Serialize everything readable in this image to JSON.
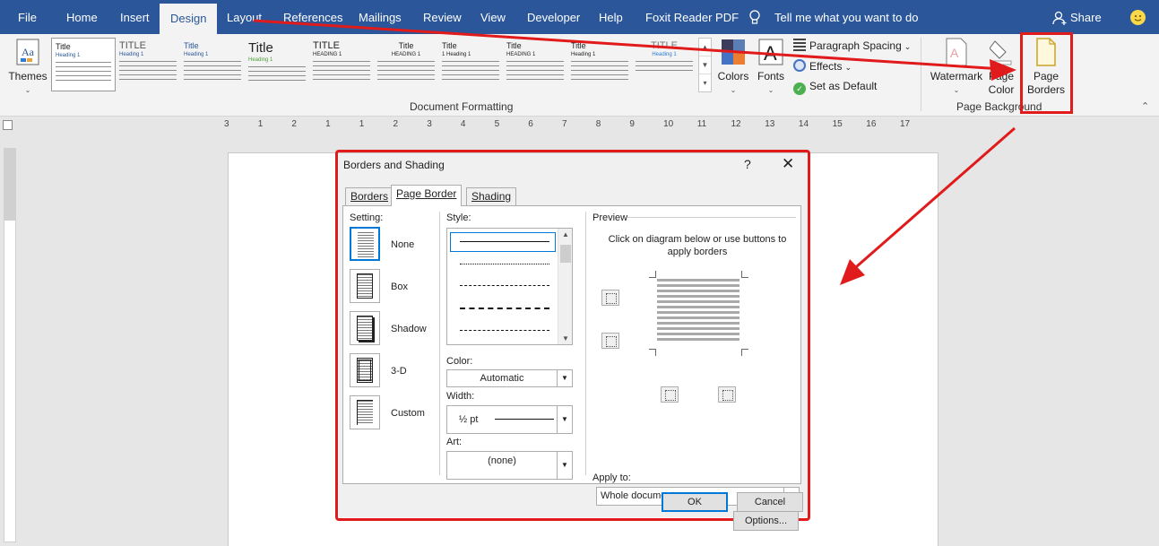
{
  "ribbon_tabs": [
    "File",
    "Home",
    "Insert",
    "Design",
    "Layout",
    "References",
    "Mailings",
    "Review",
    "View",
    "Developer",
    "Help",
    "Foxit Reader PDF"
  ],
  "active_tab": "Design",
  "tell_me": "Tell me what you want to do",
  "share": "Share",
  "ribbon": {
    "themes": "Themes",
    "styles": [
      {
        "title": "Title",
        "heading": "Heading 1"
      },
      {
        "title": "TITLE",
        "heading": "Heading 1"
      },
      {
        "title": "Title",
        "heading": "Heading 1"
      },
      {
        "title": "Title",
        "heading": "Heading 1"
      },
      {
        "title": "TITLE",
        "heading": "HEADING 1"
      },
      {
        "title": "Title",
        "heading": "HEADING 1"
      },
      {
        "title": "Title",
        "heading": "1  Heading 1"
      },
      {
        "title": "Title",
        "heading": "HEADING 1"
      },
      {
        "title": "Title",
        "heading": "Heading 1"
      },
      {
        "title": "TITLE",
        "heading": "Heading 1"
      }
    ],
    "colors": "Colors",
    "fonts": "Fonts",
    "paragraph_spacing": "Paragraph Spacing",
    "effects": "Effects",
    "set_as_default": "Set as Default",
    "document_formatting": "Document Formatting",
    "watermark": "Watermark",
    "page_color_line1": "Page",
    "page_color_line2": "Color",
    "page_borders_line1": "Page",
    "page_borders_line2": "Borders",
    "page_background": "Page Background"
  },
  "ruler_numbers": [
    "3",
    "1",
    "2",
    "1",
    "1",
    "2",
    "3",
    "4",
    "5",
    "6",
    "7",
    "8",
    "9",
    "10",
    "11",
    "12",
    "13",
    "14",
    "15",
    "16",
    "17"
  ],
  "dialog": {
    "title": "Borders and Shading",
    "help": "?",
    "close": "✕",
    "tabs": [
      "Borders",
      "Page Border",
      "Shading"
    ],
    "setting_label": "Setting:",
    "settings": [
      "None",
      "Box",
      "Shadow",
      "3-D",
      "Custom"
    ],
    "style_label": "Style:",
    "color_label": "Color:",
    "color_value": "Automatic",
    "width_label": "Width:",
    "width_value": "½ pt",
    "art_label": "Art:",
    "art_value": "(none)",
    "preview_label": "Preview",
    "preview_instructions": "Click on diagram below or use buttons to apply borders",
    "apply_label": "Apply to:",
    "apply_value": "Whole document",
    "options": "Options...",
    "ok": "OK",
    "cancel": "Cancel"
  },
  "colors": {
    "ribbon_blue": "#2b579a",
    "highlight_red": "#e11b1b",
    "focus_blue": "#0078d7"
  }
}
